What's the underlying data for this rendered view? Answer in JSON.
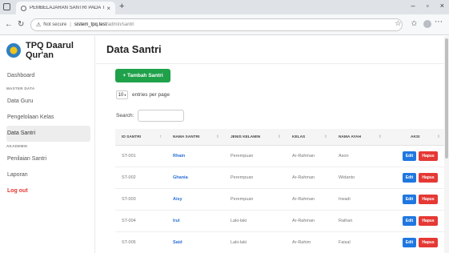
{
  "browser": {
    "tab_title": "PEMBELAJARAN SANTRI PADA TPQ",
    "tab_close": "×",
    "new_tab": "+",
    "url_security": "Not secure",
    "url_host": "sistem_tpq.test",
    "url_path": "/admin/santri",
    "window_controls": [
      "–",
      "▫",
      "×"
    ]
  },
  "sidebar": {
    "brand": "TPQ Daarul Qur'an",
    "items": [
      {
        "type": "item",
        "label": "Dashboard"
      },
      {
        "type": "header",
        "label": "MASTER DATA"
      },
      {
        "type": "item",
        "label": "Data Guru"
      },
      {
        "type": "item",
        "label": "Pengelolaan Kelas"
      },
      {
        "type": "item",
        "label": "Data Santri",
        "active": true
      },
      {
        "type": "header",
        "label": "AKADEMIK"
      },
      {
        "type": "item",
        "label": "Penilaian Santri"
      },
      {
        "type": "item",
        "label": "Laporan"
      },
      {
        "type": "item",
        "label": "Log out",
        "logout": true
      }
    ]
  },
  "main": {
    "title": "Data Santri",
    "add_button": "+ Tambah Santri",
    "entries_value": "10",
    "entries_label": "entries per page",
    "search_label": "Search:",
    "search_value": "",
    "columns": [
      "ID SANTRI",
      "NAMA SANTRI",
      "JENIS KELAMIN",
      "KELAS",
      "NAMA AYAH",
      "AKSI"
    ],
    "edit_label": "Edit",
    "delete_label": "Hapus",
    "rows": [
      {
        "id": "ST-001",
        "nama": "Rhain",
        "jk": "Perempuan",
        "kelas": "Ar-Rahman",
        "ayah": "Ason"
      },
      {
        "id": "ST-002",
        "nama": "Ghania",
        "jk": "Perempuan",
        "kelas": "Ar-Rahman",
        "ayah": "Widanto"
      },
      {
        "id": "ST-003",
        "nama": "Aisy",
        "jk": "Perempuan",
        "kelas": "Ar-Rahman",
        "ayah": "Irwadi"
      },
      {
        "id": "ST-004",
        "nama": "Irul",
        "jk": "Laki-laki",
        "kelas": "Ar-Rahman",
        "ayah": "Raihan"
      },
      {
        "id": "ST-005",
        "nama": "Said",
        "jk": "Laki-laki",
        "kelas": "Ar-Rahim",
        "ayah": "Faisal"
      }
    ]
  },
  "colors": {
    "accent_green": "#1fa14a",
    "edit_blue": "#1f77e0",
    "delete_red": "#e53935",
    "link_blue": "#2a6fd6"
  }
}
